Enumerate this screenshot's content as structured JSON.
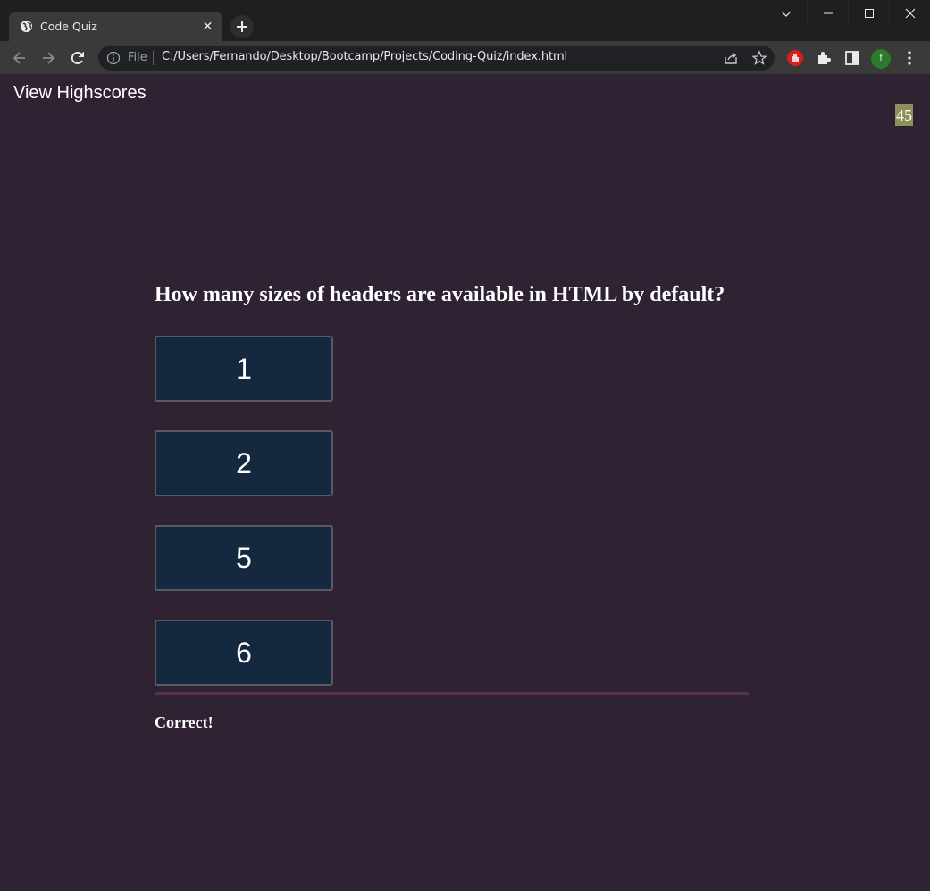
{
  "browser": {
    "tab_title": "Code Quiz",
    "tab_close_glyph": "✕",
    "file_label": "File",
    "url": "C:/Users/Fernando/Desktop/Bootcamp/Projects/Coding-Quiz/index.html",
    "profile_initial": "f",
    "icons": [
      "globe-icon",
      "close-icon",
      "plus-icon",
      "chevron-down-icon",
      "minimize-icon",
      "maximize-icon",
      "close-window-icon",
      "back-icon",
      "forward-icon",
      "reload-icon",
      "info-icon",
      "share-icon",
      "star-icon",
      "stop-extension-icon",
      "puzzle-icon",
      "side-panel-icon",
      "kebab-menu-icon"
    ]
  },
  "page": {
    "highscores_label": "View Highscores",
    "timer": "45",
    "question": "How many sizes of headers are available in HTML by default?",
    "answers": [
      "1",
      "2",
      "5",
      "6"
    ],
    "feedback": "Correct!"
  },
  "colors": {
    "page_bg": "#2e2233",
    "button_bg": "#142840",
    "timer_bg": "#8e9059",
    "divider": "#5a2e5c"
  }
}
